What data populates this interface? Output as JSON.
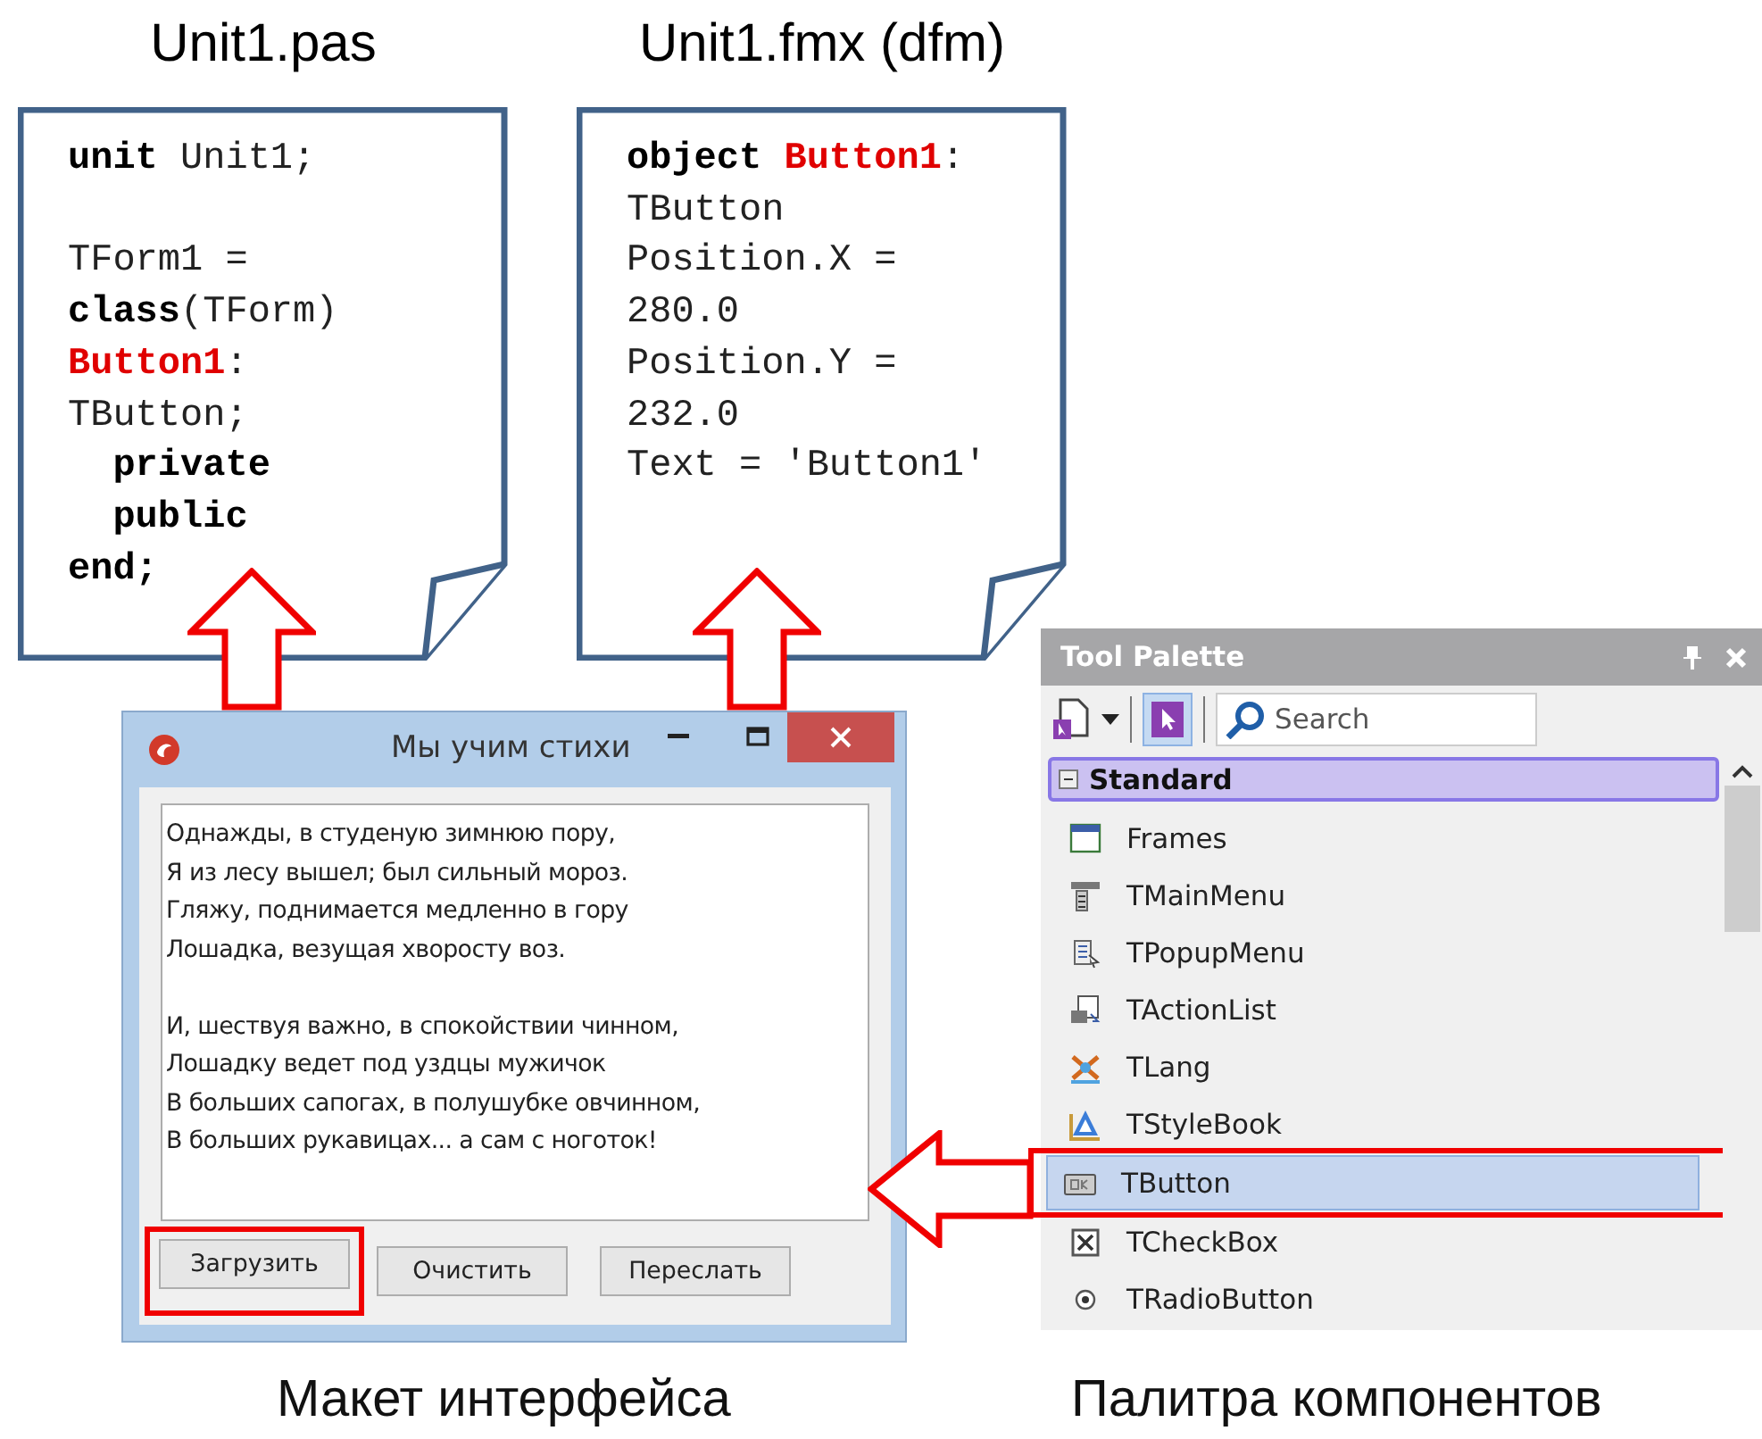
{
  "code_files": [
    {
      "title": "Unit1.pas",
      "lines": [
        {
          "kind": "code",
          "tokens": [
            {
              "text": "unit",
              "kind": "keyword"
            },
            {
              "text": " Unit1;",
              "kind": "plain"
            }
          ]
        },
        {
          "kind": "blank"
        },
        {
          "kind": "code",
          "tokens": [
            {
              "text": "TForm1 =",
              "kind": "plain"
            }
          ]
        },
        {
          "kind": "code",
          "tokens": [
            {
              "text": "class",
              "kind": "keyword"
            },
            {
              "text": "(TForm)",
              "kind": "plain"
            }
          ]
        },
        {
          "kind": "code",
          "tokens": [
            {
              "text": "Button1",
              "kind": "highlight"
            },
            {
              "text": ":",
              "kind": "plain"
            }
          ]
        },
        {
          "kind": "code",
          "tokens": [
            {
              "text": "TButton;",
              "kind": "plain"
            }
          ]
        },
        {
          "kind": "code",
          "tokens": [
            {
              "text": "  private",
              "kind": "keyword"
            }
          ]
        },
        {
          "kind": "code",
          "tokens": [
            {
              "text": "  public",
              "kind": "keyword"
            }
          ]
        },
        {
          "kind": "code",
          "tokens": [
            {
              "text": "end;",
              "kind": "keyword"
            }
          ]
        }
      ]
    },
    {
      "title": "Unit1.fmx (dfm)",
      "lines": [
        {
          "kind": "code",
          "tokens": [
            {
              "text": "object",
              "kind": "keyword"
            },
            {
              "text": " Button1",
              "kind": "highlight"
            },
            {
              "text": ":",
              "kind": "plain"
            }
          ]
        },
        {
          "kind": "code",
          "tokens": [
            {
              "text": "TButton",
              "kind": "plain"
            }
          ]
        },
        {
          "kind": "code",
          "tokens": [
            {
              "text": "Position.X =",
              "kind": "plain"
            }
          ]
        },
        {
          "kind": "code",
          "tokens": [
            {
              "text": "280.0",
              "kind": "plain"
            }
          ]
        },
        {
          "kind": "code",
          "tokens": [
            {
              "text": "Position.Y =",
              "kind": "plain"
            }
          ]
        },
        {
          "kind": "code",
          "tokens": [
            {
              "text": "232.0",
              "kind": "plain"
            }
          ]
        },
        {
          "kind": "code",
          "tokens": [
            {
              "text": "Text = 'Button1'",
              "kind": "plain"
            }
          ]
        }
      ]
    }
  ],
  "form_window": {
    "title": "Мы учим стихи",
    "memo_paragraphs": [
      [
        "Однажды, в студеную зимнюю пору,",
        "Я из лесу вышел; был сильный мороз.",
        "Гляжу, поднимается медленно в гору",
        "Лошадка, везущая хворосту воз."
      ],
      [
        "И, шествуя важно, в спокойствии чинном,",
        "Лошадку ведет под уздцы мужичок",
        "В больших сапогах, в полушубке овчинном,",
        "В больших рукавицах... а сам с ноготок!"
      ]
    ],
    "buttons": [
      {
        "label": "Загрузить",
        "highlighted": true
      },
      {
        "label": "Очистить",
        "highlighted": false
      },
      {
        "label": "Переслать",
        "highlighted": false
      }
    ]
  },
  "tool_palette": {
    "title": "Tool Palette",
    "search": {
      "placeholder": "Search"
    },
    "category": {
      "label": "Standard",
      "expanded": true
    },
    "items": [
      {
        "label": "Frames",
        "kind": "frames",
        "selected": false,
        "highlighted": false
      },
      {
        "label": "TMainMenu",
        "kind": "mainmenu",
        "selected": false,
        "highlighted": false
      },
      {
        "label": "TPopupMenu",
        "kind": "popupmenu",
        "selected": false,
        "highlighted": false
      },
      {
        "label": "TActionList",
        "kind": "actionlist",
        "selected": false,
        "highlighted": false
      },
      {
        "label": "TLang",
        "kind": "lang",
        "selected": false,
        "highlighted": false
      },
      {
        "label": "TStyleBook",
        "kind": "stylebook",
        "selected": false,
        "highlighted": false
      },
      {
        "label": "TButton",
        "kind": "button",
        "selected": true,
        "highlighted": true
      },
      {
        "label": "TCheckBox",
        "kind": "checkbox",
        "selected": false,
        "highlighted": false
      },
      {
        "label": "TRadioButton",
        "kind": "radiobutton",
        "selected": false,
        "highlighted": false
      }
    ]
  },
  "captions": [
    "Макет интерфейса",
    "Палитра компонентов"
  ]
}
